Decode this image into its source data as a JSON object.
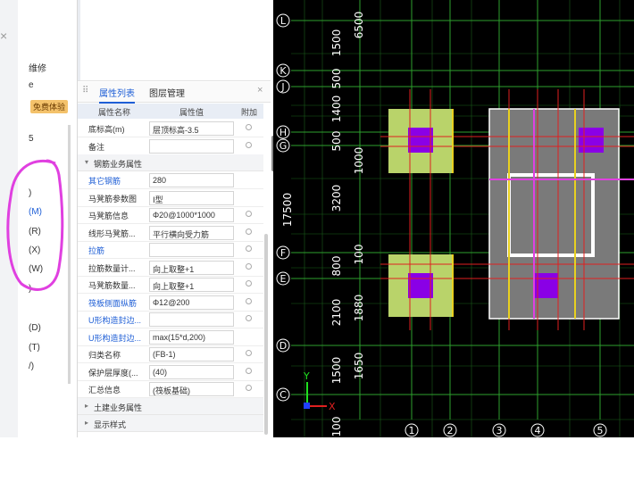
{
  "left_panel": {
    "close_glyph": "×",
    "badge": "免费体验",
    "items": [
      {
        "label": "维修",
        "blue": false
      },
      {
        "label": "e",
        "blue": false
      },
      {
        "label": "5",
        "blue": false
      },
      {
        "label": ")",
        "blue": false
      },
      {
        "label": "(M)",
        "blue": true
      },
      {
        "label": "(R)",
        "blue": false
      },
      {
        "label": "(X)",
        "blue": false
      },
      {
        "label": "(W)",
        "blue": false
      },
      {
        "label": ")",
        "blue": false
      },
      {
        "label": "(D)",
        "blue": false
      },
      {
        "label": "(T)",
        "blue": false
      },
      {
        "label": "/)",
        "blue": false
      }
    ]
  },
  "properties": {
    "tabs": [
      "属性列表",
      "图层管理"
    ],
    "active_tab": "属性列表",
    "close": "×",
    "headers": [
      "属性名称",
      "属性值",
      "附加"
    ],
    "rows": [
      {
        "name": "底标高(m)",
        "value": "层顶标高-3.5",
        "blue": false,
        "dot": true
      },
      {
        "name": "备注",
        "value": "",
        "blue": false,
        "dot": true
      },
      {
        "group": "钢筋业务属性",
        "expanded": true
      },
      {
        "name": "其它钢筋",
        "value": "280",
        "blue": true,
        "dot": false
      },
      {
        "name": "马凳筋参数图",
        "value": "Ⅰ型",
        "blue": false,
        "dot": false
      },
      {
        "name": "马凳筋信息",
        "value": "Φ20@1000*1000",
        "blue": false,
        "dot": true
      },
      {
        "name": "线形马凳筋...",
        "value": "平行横向受力筋",
        "blue": false,
        "dot": true
      },
      {
        "name": "拉筋",
        "value": "",
        "blue": true,
        "dot": true
      },
      {
        "name": "拉筋数量计...",
        "value": "向上取整+1",
        "blue": false,
        "dot": true
      },
      {
        "name": "马凳筋数量...",
        "value": "向上取整+1",
        "blue": false,
        "dot": true
      },
      {
        "name": "筏板侧面纵筋",
        "value": "Φ12@200",
        "blue": true,
        "dot": true
      },
      {
        "name": "U形构造封边...",
        "value": "",
        "blue": true,
        "dot": true
      },
      {
        "name": "U形构造封边...",
        "value": "max(15*d,200)",
        "blue": true,
        "dot": false
      },
      {
        "name": "归类名称",
        "value": "(FB-1)",
        "blue": false,
        "dot": true
      },
      {
        "name": "保护层厚度(...",
        "value": "(40)",
        "blue": false,
        "dot": true
      },
      {
        "name": "汇总信息",
        "value": "(筏板基础)",
        "blue": false,
        "dot": true
      },
      {
        "group": "土建业务属性",
        "expanded": false
      },
      {
        "group": "显示样式",
        "expanded": false
      }
    ]
  },
  "cad": {
    "row_axes": [
      "L",
      "K",
      "J",
      "H",
      "G",
      "F",
      "E",
      "D",
      "C"
    ],
    "col_axes": [
      "1",
      "2",
      "3",
      "4",
      "5"
    ],
    "dims": [
      "6500",
      "1500",
      "500",
      "1400",
      "500",
      "1000",
      "3200",
      "17500",
      "100",
      "800",
      "2100",
      "1880",
      "1500",
      "1650",
      "100"
    ],
    "colors": {
      "bg": "#000000",
      "grid_green": "#1f7a1f",
      "red": "#e02020",
      "yellow_green": "#b9d36a",
      "purple": "#8a00e6",
      "magenta": "#e040e0",
      "gray": "#7a7a7a",
      "axis_label": "#ffffff"
    }
  },
  "annotation": {
    "color": "#e040e0"
  }
}
